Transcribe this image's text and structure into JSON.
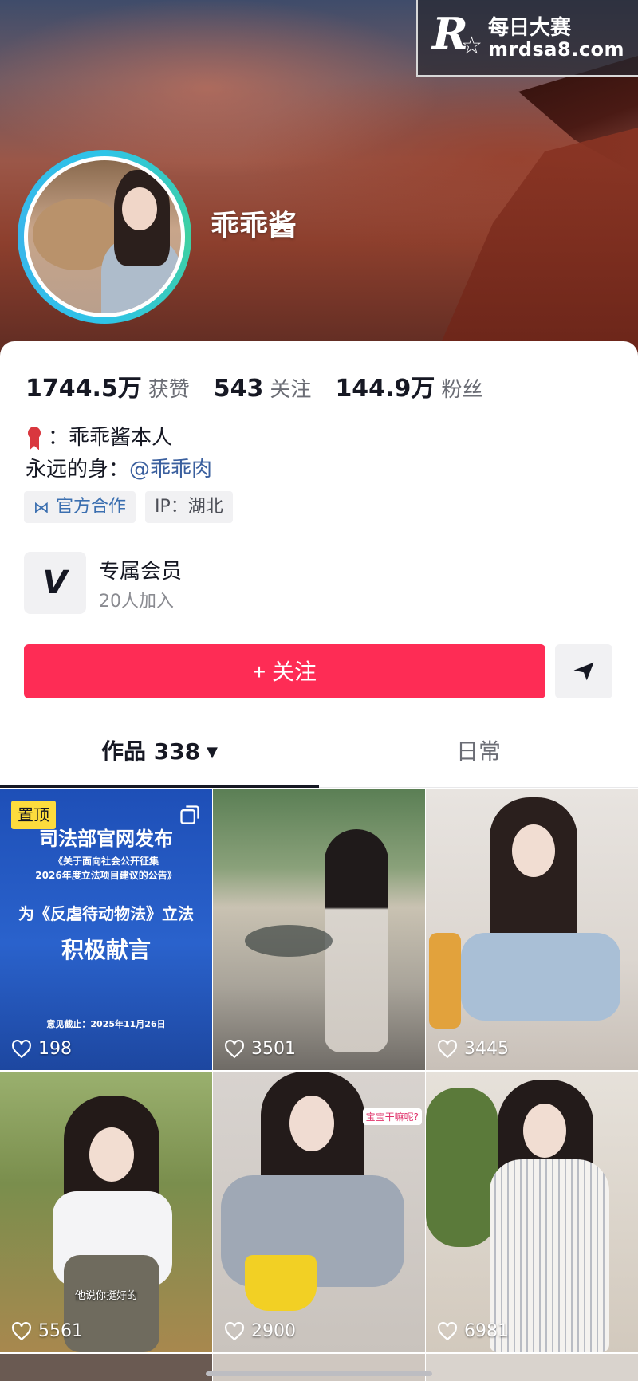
{
  "watermark": {
    "title": "每日大赛",
    "url": "mrdsa8.com"
  },
  "profile": {
    "name": "乖乖酱",
    "stats": [
      {
        "value": "1744.5万",
        "label": "获赞"
      },
      {
        "value": "543",
        "label": "关注"
      },
      {
        "value": "144.9万",
        "label": "粉丝"
      }
    ],
    "bio_line1": "：乖乖酱本人",
    "bio_line2_prefix": "永远的身：",
    "bio_line2_mention": "@乖乖肉",
    "tags": [
      {
        "label": "官方合作",
        "icon": "handshake-icon"
      },
      {
        "label": "IP：湖北"
      }
    ],
    "member": {
      "title": "专属会员",
      "subtitle": "20人加入"
    }
  },
  "actions": {
    "follow_label": "+ 关注",
    "share_icon": "send-icon"
  },
  "tabs": [
    {
      "label": "作品 338",
      "caret": "▼"
    },
    {
      "label": "日常"
    }
  ],
  "videos": [
    {
      "likes": "198",
      "pinned_label": "置顶",
      "notice": {
        "line1": "司法部官网发布",
        "line2": "《关于面向社会公开征集",
        "line3": "2026年度立法项目建议的公告》",
        "line4": "为《反虐待动物法》立法",
        "line5": "积极献言",
        "line6": "意见截止：2025年11月26日"
      }
    },
    {
      "likes": "3501"
    },
    {
      "likes": "3445"
    },
    {
      "likes": "5561",
      "caption": "他说你挺好的"
    },
    {
      "likes": "2900",
      "caption": "宝宝干嘛呢?"
    },
    {
      "likes": "6981"
    }
  ],
  "colors": {
    "accent": "#fe2c55",
    "mention": "#3a5f9e",
    "pin": "#fddc3d"
  }
}
